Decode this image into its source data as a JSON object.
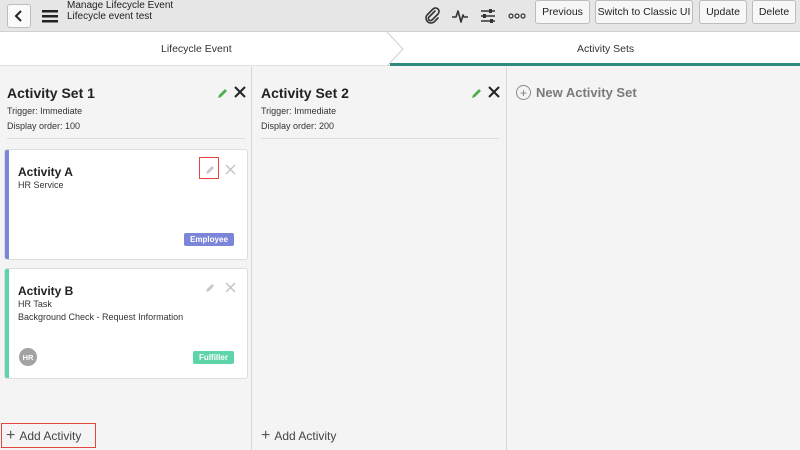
{
  "header": {
    "title_line1": "Manage Lifecycle Event",
    "title_line2": "Lifecycle event test",
    "icons": [
      "attachment-icon",
      "activity-pulse-icon",
      "settings-sliders-icon",
      "more-options-icon"
    ],
    "buttons": {
      "previous": "Previous",
      "switch_classic": "Switch to Classic UI",
      "update": "Update",
      "delete": "Delete"
    }
  },
  "tabs": [
    {
      "label": "Lifecycle Event",
      "active": false
    },
    {
      "label": "Activity Sets",
      "active": true
    }
  ],
  "colors": {
    "accent": "#2e8a7d",
    "employee_bar": "#7b86d9",
    "employee_badge": "#7b86d9",
    "fulfiller_bar": "#5ed4a9",
    "fulfiller_badge": "#5ed4a9",
    "highlight": "#e3473b"
  },
  "activity_sets": [
    {
      "title": "Activity Set 1",
      "trigger": "Trigger: Immediate",
      "display_order": "Display order: 100",
      "add_label": "Add Activity",
      "activities": [
        {
          "title": "Activity A",
          "lines": [
            "HR Service"
          ],
          "badge": "Employee",
          "avatar": ""
        },
        {
          "title": "Activity B",
          "lines": [
            "HR Task",
            "Background Check - Request Information"
          ],
          "badge": "Fulfiller",
          "avatar": "HR"
        }
      ]
    },
    {
      "title": "Activity Set 2",
      "trigger": "Trigger: Immediate",
      "display_order": "Display order: 200",
      "add_label": "Add Activity",
      "activities": []
    }
  ],
  "new_activity_set_label": "New Activity Set"
}
